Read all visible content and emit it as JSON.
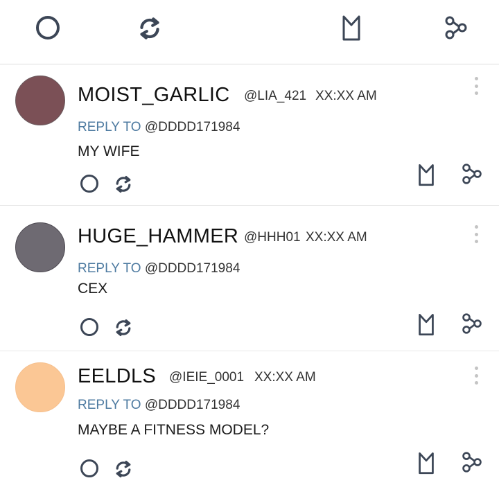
{
  "toolbar": {
    "icons": [
      "like-circle-icon",
      "repost-icon",
      "bookmark-icon",
      "share-icon"
    ]
  },
  "colors": {
    "icon": "#3c4656",
    "reply_keyword": "#4d7aa0"
  },
  "posts": [
    {
      "username": "MOIST_GARLIC",
      "handle": "@LIA_421",
      "time": "XX:XX AM",
      "reply_label": "REPLY TO",
      "reply_to": "@DDDD171984",
      "text": "MY WIFE",
      "avatar_color": "#7b5056"
    },
    {
      "username": "HUGE_HAMMER",
      "handle": "@HHH01",
      "time": "XX:XX AM",
      "reply_label": "REPLY TO",
      "reply_to": "@DDDD171984",
      "text": "CEX",
      "avatar_color": "#6e6a72"
    },
    {
      "username": "EELDLS",
      "handle": "@IEIE_0001",
      "time": "XX:XX AM",
      "reply_label": "REPLY TO",
      "reply_to": "@DDDD171984",
      "text": "MAYBE A FITNESS MODEL?",
      "avatar_color": "#fbc795"
    }
  ]
}
